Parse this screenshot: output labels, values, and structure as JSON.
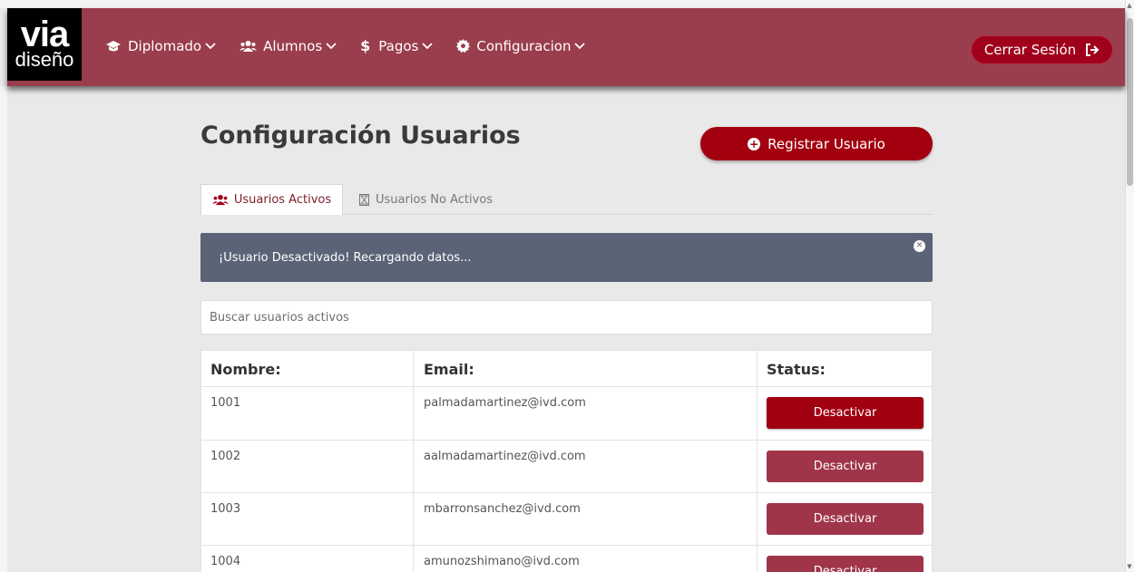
{
  "logo": {
    "line1": "via",
    "line2": "diseño"
  },
  "nav": {
    "items": [
      {
        "label": "Diplomado",
        "icon": "graduation-cap-icon"
      },
      {
        "label": "Alumnos",
        "icon": "users-icon"
      },
      {
        "label": "Pagos",
        "icon": "dollar-icon"
      },
      {
        "label": "Configuracion",
        "icon": "gear-icon"
      }
    ],
    "logout_label": "Cerrar Sesión"
  },
  "page": {
    "title": "Configuración Usuarios",
    "register_label": "Registrar Usuario"
  },
  "tabs": {
    "active_label": "Usuarios Activos",
    "inactive_label": "Usuarios No Activos"
  },
  "alert": {
    "message": "¡Usuario Desactivado! Recargando datos..."
  },
  "search": {
    "placeholder": "Buscar usuarios activos"
  },
  "table": {
    "headers": [
      "Nombre:",
      "Email:",
      "Status:"
    ],
    "rows": [
      {
        "nombre": "1001",
        "email": "palmadamartinez@ivd.com",
        "action": "Desactivar"
      },
      {
        "nombre": "1002",
        "email": "aalmadamartinez@ivd.com",
        "action": "Desactivar"
      },
      {
        "nombre": "1003",
        "email": "mbarronsanchez@ivd.com",
        "action": "Desactivar"
      },
      {
        "nombre": "1004",
        "email": "amunozshimano@ivd.com",
        "action": "Desactivar"
      }
    ]
  },
  "colors": {
    "navbar": "#9a3d4c",
    "primary": "#a3000f",
    "alert": "#5b6477",
    "button": "#a0354a"
  }
}
